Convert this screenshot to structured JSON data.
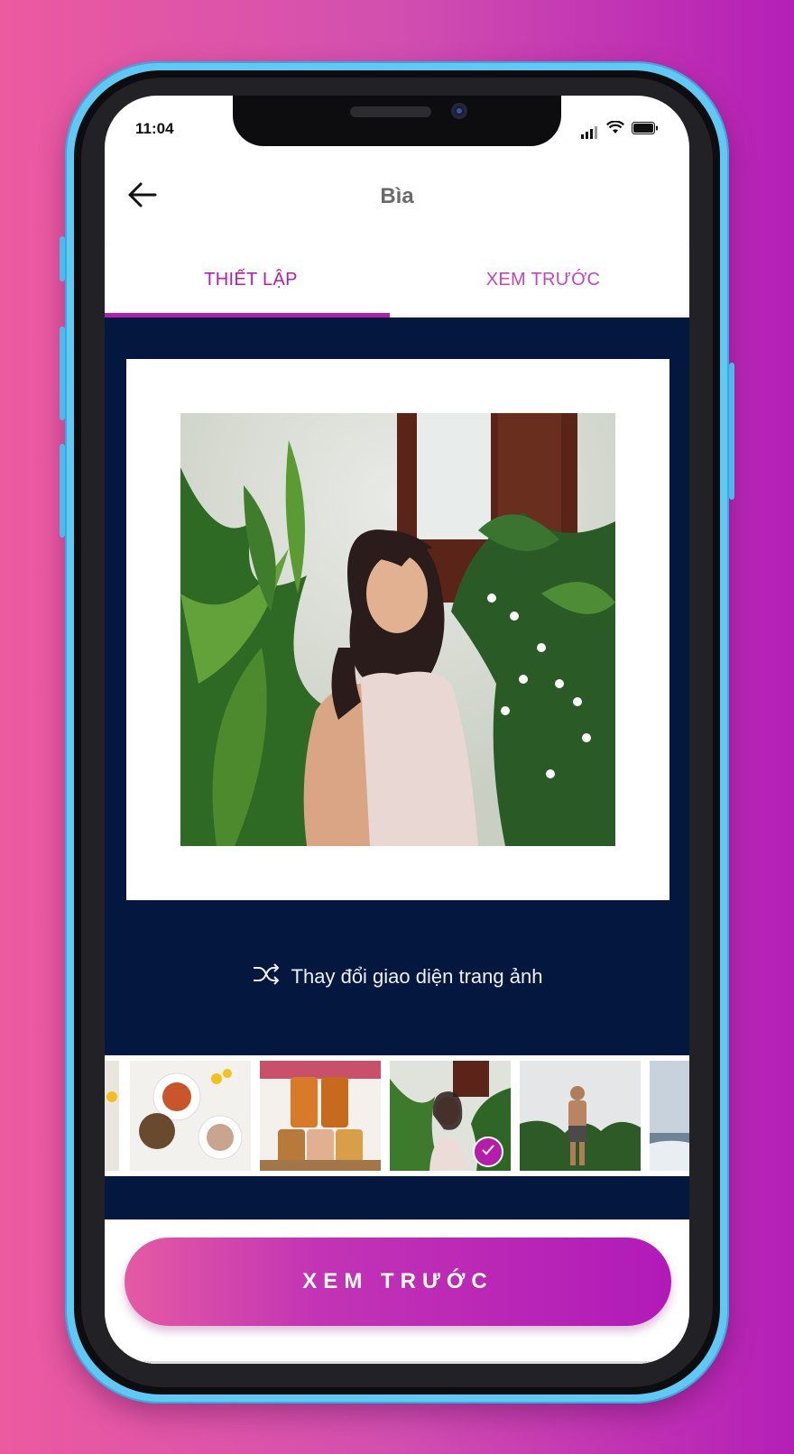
{
  "status_bar": {
    "time": "11:04"
  },
  "header": {
    "title": "Bìa",
    "back_icon": "arrow-left-icon"
  },
  "tabs": [
    {
      "label": "THIẾT LẬP",
      "active": true
    },
    {
      "label": "XEM TRƯỚC",
      "active": false
    }
  ],
  "change_layout": {
    "label": "Thay đổi giao diện trang ảnh",
    "icon": "shuffle-icon"
  },
  "thumbnails": [
    {
      "subject": "partial-photo",
      "selected": false
    },
    {
      "subject": "food-plates",
      "selected": false
    },
    {
      "subject": "jars",
      "selected": false
    },
    {
      "subject": "woman-portrait",
      "selected": true
    },
    {
      "subject": "man-in-garden",
      "selected": false
    },
    {
      "subject": "beach-partial",
      "selected": false
    }
  ],
  "bottom_button": {
    "label": "XEM TRƯỚC"
  },
  "colors": {
    "accent": "#b51dab",
    "dark_bg": "#03173f",
    "gradient_start": "#ec5aa0",
    "gradient_end": "#b41fb6"
  }
}
